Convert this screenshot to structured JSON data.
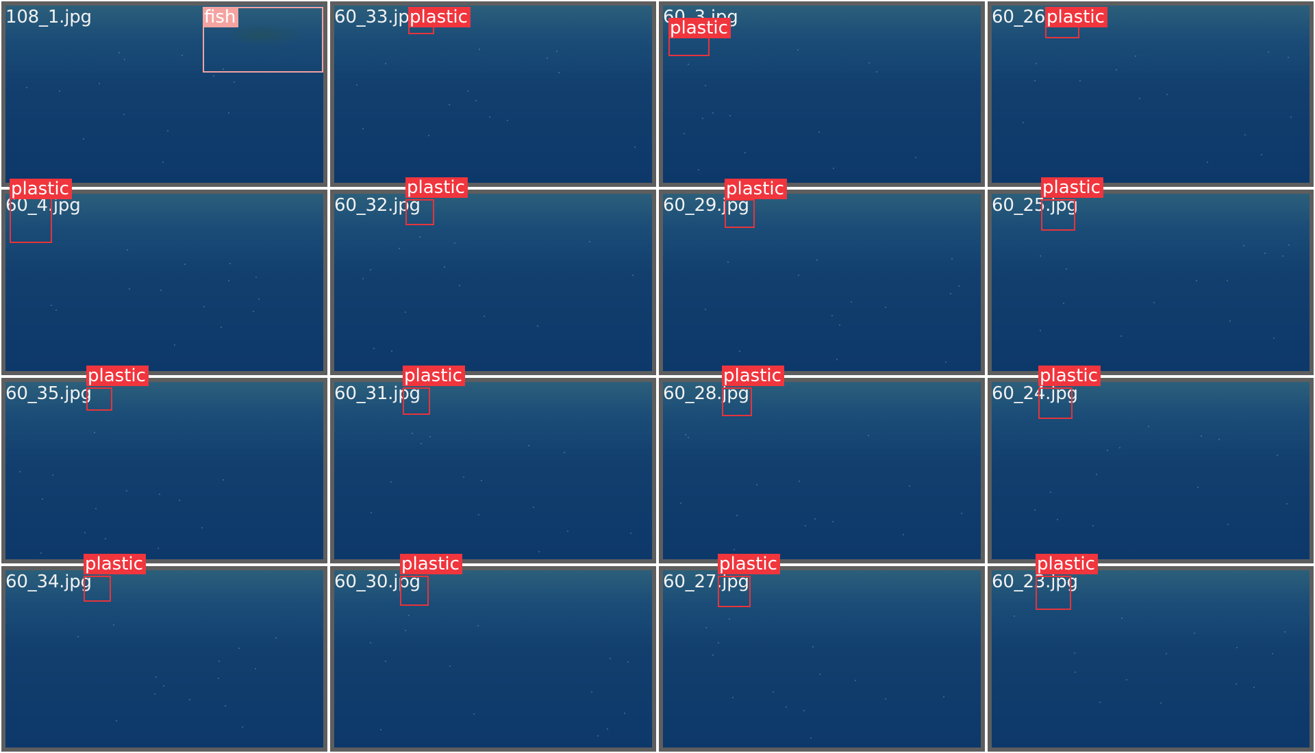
{
  "tiles": [
    {
      "filename": "108_1.jpg",
      "label": "fish"
    },
    {
      "filename": "60_33.jpg",
      "label": "plastic"
    },
    {
      "filename": "60_3.jpg",
      "label": "plastic"
    },
    {
      "filename": "60_26.jpg",
      "label": "plastic"
    },
    {
      "filename": "60_4.jpg",
      "label": "plastic"
    },
    {
      "filename": "60_32.jpg",
      "label": "plastic"
    },
    {
      "filename": "60_29.jpg",
      "label": "plastic"
    },
    {
      "filename": "60_25.jpg",
      "label": "plastic"
    },
    {
      "filename": "60_35.jpg",
      "label": "plastic"
    },
    {
      "filename": "60_31.jpg",
      "label": "plastic"
    },
    {
      "filename": "60_28.jpg",
      "label": "plastic"
    },
    {
      "filename": "60_24.jpg",
      "label": "plastic"
    },
    {
      "filename": "60_34.jpg",
      "label": "plastic"
    },
    {
      "filename": "60_30.jpg",
      "label": "plastic"
    },
    {
      "filename": "60_27.jpg",
      "label": "plastic"
    },
    {
      "filename": "60_23.jpg",
      "label": "plastic"
    }
  ],
  "colors": {
    "plastic_box": "#e8343a",
    "plastic_label_bg": "#f0353d",
    "fish_box": "#f4a3a1",
    "tile_border": "#5e5e5e",
    "water": "#0d386a"
  }
}
